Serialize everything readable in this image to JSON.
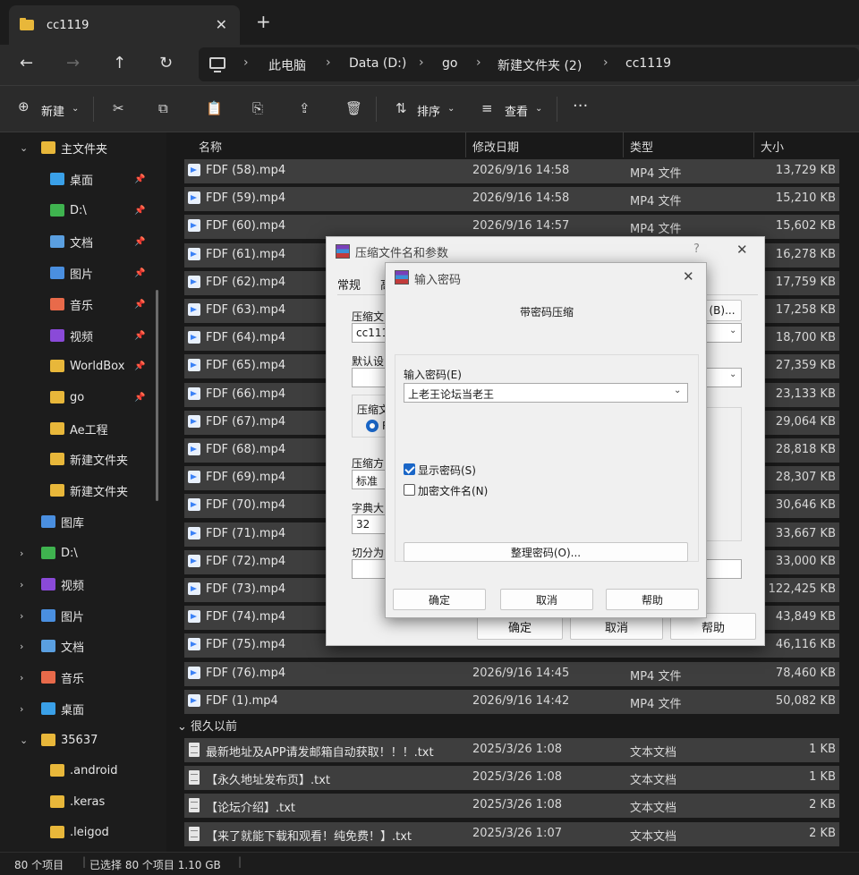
{
  "window": {
    "tab_title": "cc1119",
    "tab_close": "✕",
    "new_tab": "+"
  },
  "nav_buttons": {
    "back": "←",
    "forward": "→",
    "up": "↑",
    "refresh": "↻"
  },
  "breadcrumb": {
    "items": [
      "此电脑",
      "Data (D:)",
      "go",
      "新建文件夹 (2)",
      "cc1119"
    ],
    "separator": "›"
  },
  "toolbar": {
    "new_label": "新建",
    "sort_label": "排序",
    "view_label": "查看",
    "more": "···"
  },
  "sidebar": {
    "items": [
      {
        "label": "主文件夹",
        "chev": "⌄",
        "pin": false
      },
      {
        "label": "桌面",
        "pin": true
      },
      {
        "label": "D:\\",
        "pin": true
      },
      {
        "label": "文档",
        "pin": true
      },
      {
        "label": "图片",
        "pin": true
      },
      {
        "label": "音乐",
        "pin": true
      },
      {
        "label": "视频",
        "pin": true
      },
      {
        "label": "WorldBox",
        "pin": true
      },
      {
        "label": "go",
        "pin": true
      },
      {
        "label": "Ae工程",
        "pin": false
      },
      {
        "label": "新建文件夹",
        "pin": false
      },
      {
        "label": "新建文件夹",
        "pin": false
      },
      {
        "label": "图库",
        "pin": false
      },
      {
        "label": "D:\\",
        "chev": "›"
      },
      {
        "label": "视频",
        "chev": "›"
      },
      {
        "label": "图片",
        "chev": "›"
      },
      {
        "label": "文档",
        "chev": "›"
      },
      {
        "label": "音乐",
        "chev": "›"
      },
      {
        "label": "桌面",
        "chev": "›"
      },
      {
        "label": "35637",
        "chev": "⌄"
      },
      {
        "label": ".android"
      },
      {
        "label": ".keras"
      },
      {
        "label": ".leigod"
      }
    ]
  },
  "columns": {
    "name": "名称",
    "date": "修改日期",
    "type": "类型",
    "size": "大小"
  },
  "files": [
    {
      "name": "FDF (58).mp4",
      "date": "2026/9/16 14:58",
      "type": "MP4 文件",
      "size": "13,729 KB"
    },
    {
      "name": "FDF (59).mp4",
      "date": "2026/9/16 14:58",
      "type": "MP4 文件",
      "size": "15,210 KB"
    },
    {
      "name": "FDF (60).mp4",
      "date": "2026/9/16 14:57",
      "type": "MP4 文件",
      "size": "15,602 KB"
    },
    {
      "name": "FDF (61).mp4",
      "date": "",
      "type": "",
      "size": "16,278 KB"
    },
    {
      "name": "FDF (62).mp4",
      "date": "",
      "type": "",
      "size": "17,759 KB"
    },
    {
      "name": "FDF (63).mp4",
      "date": "",
      "type": "",
      "size": "17,258 KB"
    },
    {
      "name": "FDF (64).mp4",
      "date": "",
      "type": "",
      "size": "18,700 KB"
    },
    {
      "name": "FDF (65).mp4",
      "date": "",
      "type": "",
      "size": "27,359 KB"
    },
    {
      "name": "FDF (66).mp4",
      "date": "",
      "type": "",
      "size": "23,133 KB"
    },
    {
      "name": "FDF (67).mp4",
      "date": "",
      "type": "",
      "size": "29,064 KB"
    },
    {
      "name": "FDF (68).mp4",
      "date": "",
      "type": "",
      "size": "28,818 KB"
    },
    {
      "name": "FDF (69).mp4",
      "date": "",
      "type": "",
      "size": "28,307 KB"
    },
    {
      "name": "FDF (70).mp4",
      "date": "",
      "type": "",
      "size": "30,646 KB"
    },
    {
      "name": "FDF (71).mp4",
      "date": "",
      "type": "",
      "size": "33,667 KB"
    },
    {
      "name": "FDF (72).mp4",
      "date": "",
      "type": "",
      "size": "33,000 KB"
    },
    {
      "name": "FDF (73).mp4",
      "date": "",
      "type": "",
      "size": "122,425 KB"
    },
    {
      "name": "FDF (74).mp4",
      "date": "",
      "type": "",
      "size": "43,849 KB"
    },
    {
      "name": "FDF (75).mp4",
      "date": "",
      "type": "",
      "size": "46,116 KB"
    },
    {
      "name": "FDF (76).mp4",
      "date": "2026/9/16 14:45",
      "type": "MP4 文件",
      "size": "78,460 KB"
    },
    {
      "name": "FDF (1).mp4",
      "date": "2026/9/16 14:42",
      "type": "MP4 文件",
      "size": "50,082 KB"
    }
  ],
  "group_label": "很久以前",
  "txt_files": [
    {
      "name": "最新地址及APP请发邮箱自动获取！！！.txt",
      "date": "2025/3/26 1:08",
      "type": "文本文档",
      "size": "1 KB"
    },
    {
      "name": "【永久地址发布页】.txt",
      "date": "2025/3/26 1:08",
      "type": "文本文档",
      "size": "1 KB"
    },
    {
      "name": "【论坛介绍】.txt",
      "date": "2025/3/26 1:08",
      "type": "文本文档",
      "size": "2 KB"
    },
    {
      "name": "【来了就能下载和观看！纯免费！】.txt",
      "date": "2025/3/26 1:07",
      "type": "文本文档",
      "size": "2 KB"
    }
  ],
  "status": {
    "count": "80 个项目",
    "selected": "已选择 80 个项目  1.10 GB"
  },
  "archive_dialog": {
    "title": "压缩文件名和参数",
    "help": "?",
    "close": "✕",
    "tab_general": "常规",
    "tab_partial": "高",
    "label_archive": "压缩文",
    "field_archive": "cc1119",
    "browse": "(B)...",
    "label_profile": "默认设",
    "label_format": "压缩文",
    "radio_partial": "R",
    "label_method": "压缩方",
    "method": "标准",
    "label_dict": "字典大",
    "dict": "32",
    "label_split": "切分为",
    "ok": "确定",
    "cancel": "取消",
    "help_btn": "帮助"
  },
  "password_dialog": {
    "title": "输入密码",
    "close": "✕",
    "heading": "带密码压缩",
    "label": "输入密码(E)",
    "password": "上老王论坛当老王",
    "show_password": "显示密码(S)",
    "encrypt_names": "加密文件名(N)",
    "organize": "整理密码(O)...",
    "ok": "确定",
    "cancel": "取消",
    "help": "帮助"
  },
  "colors": {
    "row_bg": "#3e3e3e",
    "accent": "#1a66c7",
    "folder": "#e8b73a"
  }
}
